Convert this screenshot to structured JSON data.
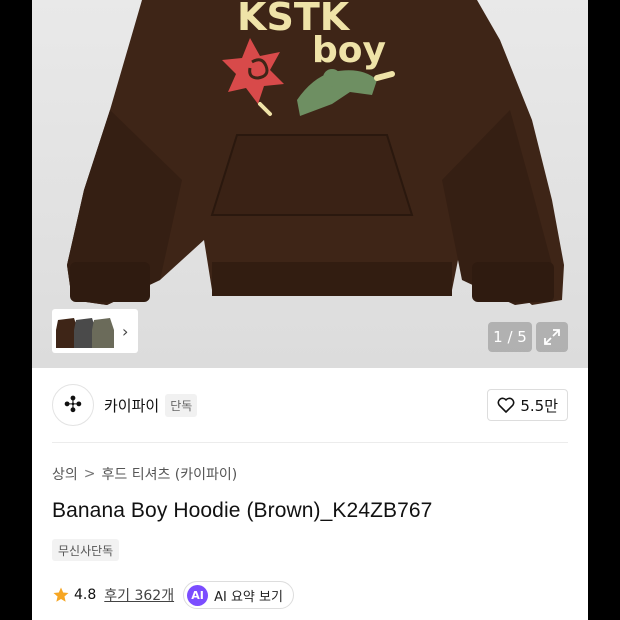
{
  "gallery": {
    "counter": "1 / 5",
    "graphic_text_line1": "KSTK",
    "graphic_text_line2": "boy"
  },
  "brand": {
    "logo_glyph": "✣",
    "name": "카이파이",
    "tag": "단독",
    "likes": "5.5만"
  },
  "breadcrumb": {
    "category": "상의",
    "separator": ">",
    "subcategory": "후드 티셔츠 (카이파이)"
  },
  "product": {
    "title": "Banana Boy Hoodie (Brown)_K24ZB767",
    "exclusive_badge": "무신사단독",
    "rating": "4.8",
    "reviews": "후기 362개",
    "ai_badge": "AI",
    "ai_summary_label": "AI 요약 보기"
  },
  "colors": {
    "hoodie": "#3e2517",
    "star": "#f6a623",
    "ai_accent": "#7b4dff"
  }
}
